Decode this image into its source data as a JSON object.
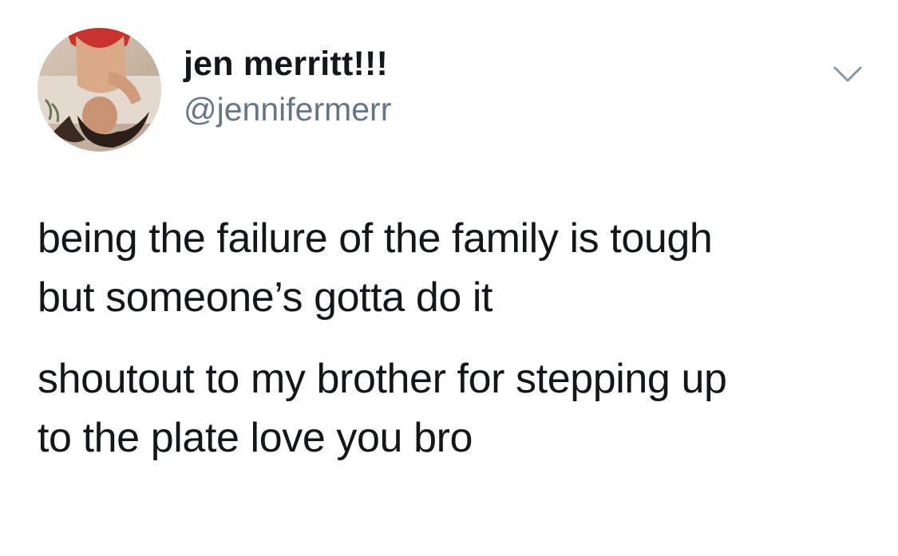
{
  "tweet": {
    "author": {
      "display_name": "jen merritt!!!",
      "handle": "@jennifermerr",
      "avatar_icon": "profile-photo"
    },
    "menu_icon": "chevron-down-icon",
    "paragraphs": [
      "being the failure of the family is tough\nbut someone’s gotta do it",
      "shoutout to my brother for stepping up\nto the plate love you bro"
    ]
  },
  "colors": {
    "text_primary": "#14171a",
    "text_secondary": "#657786",
    "chevron": "#8899a6",
    "background": "#ffffff"
  }
}
